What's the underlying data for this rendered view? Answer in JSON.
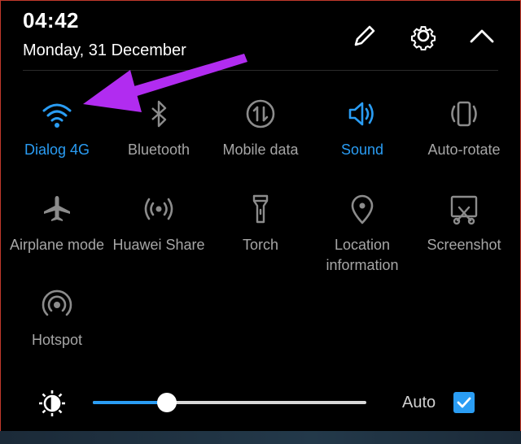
{
  "status": {
    "time": "04:42",
    "date": "Monday, 31 December"
  },
  "header_icons": [
    "edit-icon",
    "settings-gear-icon",
    "collapse-chevron-icon"
  ],
  "tiles": [
    {
      "label": "Dialog 4G",
      "icon": "wifi-icon",
      "active": true
    },
    {
      "label": "Bluetooth",
      "icon": "bluetooth-icon",
      "active": false
    },
    {
      "label": "Mobile data",
      "icon": "mobile-data-icon",
      "active": false
    },
    {
      "label": "Sound",
      "icon": "sound-icon",
      "active": true
    },
    {
      "label": "Auto-rotate",
      "icon": "auto-rotate-icon",
      "active": false
    },
    {
      "label": "Airplane mode",
      "icon": "airplane-icon",
      "active": false
    },
    {
      "label": "Huawei Share",
      "icon": "huawei-share-icon",
      "active": false
    },
    {
      "label": "Torch",
      "icon": "torch-icon",
      "active": false
    },
    {
      "label": "Location information",
      "icon": "location-pin-icon",
      "active": false
    },
    {
      "label": "Screenshot",
      "icon": "screenshot-icon",
      "active": false
    },
    {
      "label": "Hotspot",
      "icon": "hotspot-icon",
      "active": false
    }
  ],
  "brightness": {
    "level": 0.27,
    "auto_label": "Auto",
    "auto_checked": true
  },
  "colors": {
    "accent": "#2a9df4",
    "inactive": "#a6a6a6",
    "annotation_arrow": "#b12cf0"
  }
}
